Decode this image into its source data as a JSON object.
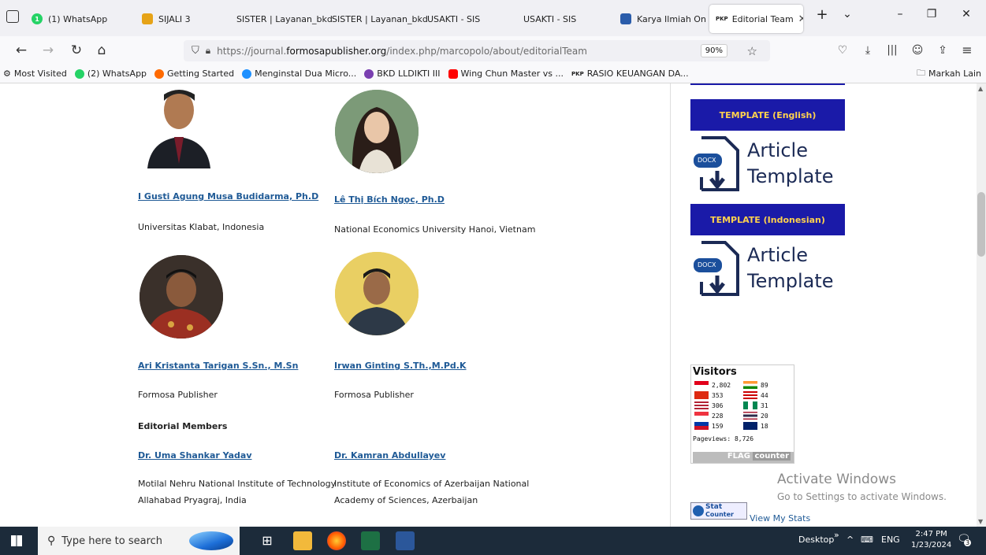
{
  "browser": {
    "tabs": [
      {
        "label": "(1) WhatsApp",
        "color": "#25d366",
        "active": false
      },
      {
        "label": "SIJALI 3",
        "color": "#e6a317",
        "active": false
      },
      {
        "label": "SISTER | Layanan_bkd",
        "color": "",
        "active": false
      },
      {
        "label": "SISTER | Layanan_bkd",
        "color": "",
        "active": false
      },
      {
        "label": "USAKTI - SIS",
        "color": "",
        "active": false
      },
      {
        "label": "USAKTI - SIS",
        "color": "",
        "active": false
      },
      {
        "label": "Karya Ilmiah Onli",
        "color": "#2a5caa",
        "active": false
      },
      {
        "label": "Editorial Team",
        "color": "",
        "active": true
      }
    ],
    "tab_badge_pkp": "PKP",
    "url": {
      "prefix": "https://journal.",
      "host": "formosapublisher.org",
      "path": "/index.php/marcopolo/about/editorialTeam"
    },
    "zoom": "90%",
    "bookmarks": [
      {
        "label": "Most Visited",
        "color": "#666"
      },
      {
        "label": "(2) WhatsApp",
        "color": "#25d366"
      },
      {
        "label": "Getting Started",
        "color": "#ff6a00"
      },
      {
        "label": "Menginstal Dua Micro...",
        "color": "#1e90ff"
      },
      {
        "label": "BKD LLDIKTI III",
        "color": "#7a3fb0"
      },
      {
        "label": "Wing Chun Master vs ...",
        "color": "#ff0000"
      },
      {
        "label": "RASIO KEUANGAN DA...",
        "color": "#333"
      }
    ],
    "bookmarks_other": "Markah Lain"
  },
  "people": [
    {
      "name": "I Gusti Agung Musa Budidarma, Ph.D",
      "affiliation": [
        "Universitas Klabat, Indonesia"
      ]
    },
    {
      "name": "Lê Thị Bích Ngọc, Ph.D",
      "affiliation": [
        "National Economics University Hanoi, Vietnam"
      ]
    },
    {
      "name": "Ari Kristanta Tarigan S.Sn., M.Sn ",
      "affiliation": [
        "Formosa Publisher"
      ]
    },
    {
      "name": "Irwan Ginting S.Th.,M.Pd.K",
      "affiliation": [
        "Formosa Publisher"
      ]
    },
    {
      "name": "Dr. Uma Shankar Yadav",
      "affiliation": [
        "Motilal Nehru National Institute of Technology",
        "Allahabad Pryagraj, India"
      ]
    },
    {
      "name": "Dr. Kamran Abdullayev",
      "affiliation": [
        "Institute of Economics of Azerbaijan National",
        "Academy of Sciences, Azerbaijan"
      ]
    }
  ],
  "section_editorial_members": "Editorial Members",
  "sidebar": {
    "template_en": "TEMPLATE (English)",
    "template_id": "TEMPLATE (Indonesian)",
    "docx": "DOCX",
    "article": "Article",
    "template_word": "Template",
    "visitors_title": "Visitors",
    "visitors": [
      {
        "count": "2,802",
        "color": "#e2001a"
      },
      {
        "count": "89",
        "color": "#ff9933"
      },
      {
        "count": "353",
        "color": "#de2910"
      },
      {
        "count": "44",
        "color": "#cc0001"
      },
      {
        "count": "306",
        "color": "#3c3b6e"
      },
      {
        "count": "31",
        "color": "#008751"
      },
      {
        "count": "228",
        "color": "#ef3340"
      },
      {
        "count": "20",
        "color": "#241d4f"
      },
      {
        "count": "159",
        "color": "#0038a8"
      },
      {
        "count": "18",
        "color": "#012169"
      }
    ],
    "pageviews": "Pageviews: 8,726",
    "flag_counter": "FLAG",
    "flag_counter2": "counter",
    "statcounter": "Stat",
    "statcounter2": "Counter",
    "view_stats": "View My Stats",
    "activate_title": "Activate Windows",
    "activate_sub": "Go to Settings to activate Windows."
  },
  "taskbar": {
    "search_placeholder": "Type here to search",
    "desktop": "Desktop",
    "lang": "ENG",
    "time": "2:47 PM",
    "date": "1/23/2024",
    "notif_count": "3"
  }
}
